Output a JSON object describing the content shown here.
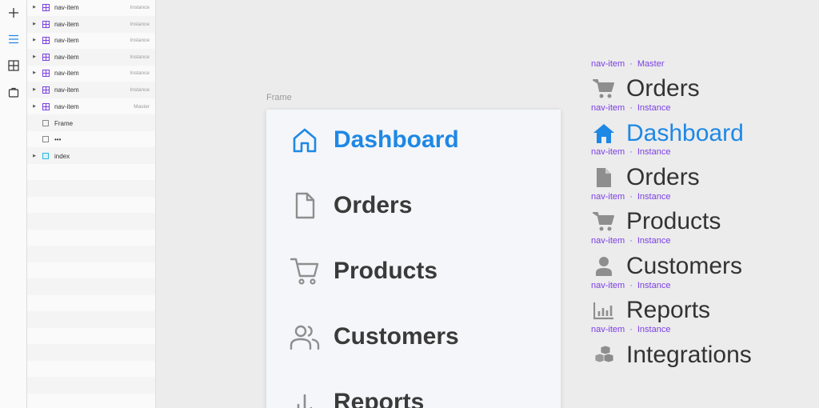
{
  "layers": {
    "items": [
      {
        "name": "nav-item",
        "tag": "Instance"
      },
      {
        "name": "nav-item",
        "tag": "Instance"
      },
      {
        "name": "nav-item",
        "tag": "Instance"
      },
      {
        "name": "nav-item",
        "tag": "Instance"
      },
      {
        "name": "nav-item",
        "tag": "Instance"
      },
      {
        "name": "nav-item",
        "tag": "Instance"
      },
      {
        "name": "nav-item",
        "tag": "Master"
      },
      {
        "name": "Frame",
        "tag": ""
      },
      {
        "name": "•••",
        "tag": ""
      },
      {
        "name": "index",
        "tag": ""
      }
    ]
  },
  "canvas": {
    "frame_label": "Frame",
    "nav": [
      {
        "label": "Dashboard",
        "icon": "home-outline-icon",
        "active": true
      },
      {
        "label": "Orders",
        "icon": "document-outline-icon",
        "active": false
      },
      {
        "label": "Products",
        "icon": "cart-outline-icon",
        "active": false
      },
      {
        "label": "Customers",
        "icon": "users-outline-icon",
        "active": false
      },
      {
        "label": "Reports",
        "icon": "bar-chart-icon",
        "active": false
      }
    ]
  },
  "components": [
    {
      "tag_name": "nav-item",
      "tag_kind": "Master",
      "label": "Orders",
      "icon": "cart-icon",
      "active": false
    },
    {
      "tag_name": "nav-item",
      "tag_kind": "Instance",
      "label": "Dashboard",
      "icon": "home-icon",
      "active": true
    },
    {
      "tag_name": "nav-item",
      "tag_kind": "Instance",
      "label": "Orders",
      "icon": "document-icon",
      "active": false
    },
    {
      "tag_name": "nav-item",
      "tag_kind": "Instance",
      "label": "Products",
      "icon": "cart-icon",
      "active": false
    },
    {
      "tag_name": "nav-item",
      "tag_kind": "Instance",
      "label": "Customers",
      "icon": "user-icon",
      "active": false
    },
    {
      "tag_name": "nav-item",
      "tag_kind": "Instance",
      "label": "Reports",
      "icon": "bar-chart-icon",
      "active": false
    },
    {
      "tag_name": "",
      "tag_kind": "",
      "label": "Integrations",
      "icon": "cubes-icon",
      "active": false
    }
  ],
  "colors": {
    "accent": "#1e88e5",
    "component_tag": "#7b3fe4",
    "icon_gray": "#8e8e8e"
  }
}
